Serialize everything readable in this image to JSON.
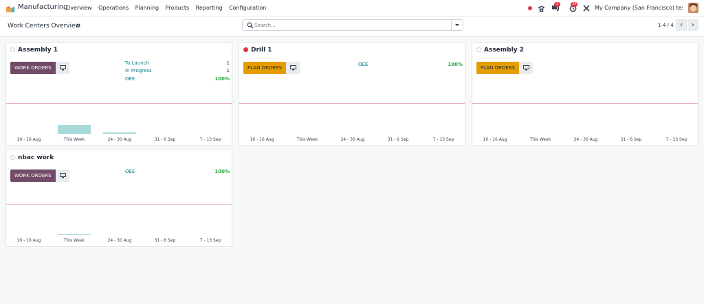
{
  "app": {
    "name": "Manufacturing"
  },
  "menu": [
    "Overview",
    "Operations",
    "Planning",
    "Products",
    "Reporting",
    "Configuration"
  ],
  "systray": {
    "chat_count": "2",
    "activity_count": "34",
    "company": "My Company (San Francisco) test te..."
  },
  "control": {
    "title": "Work Centers Overview",
    "search_placeholder": "Search...",
    "pager": "1-4 / 4"
  },
  "colors": {
    "brand": "#714b67",
    "plan": "#e59d00",
    "link": "#017e84",
    "success": "#28a745",
    "danger": "#dc3545",
    "bar": "#a6dbda"
  },
  "x_labels": [
    "10 - 16 Aug",
    "This Week",
    "24 - 30 Aug",
    "31 - 6 Sep",
    "7 - 13 Sep"
  ],
  "cards": [
    {
      "name": "Assembly 1",
      "status": "grey",
      "button": "WORK ORDERS",
      "stats": [
        {
          "label": "To Launch",
          "value": "1"
        },
        {
          "label": "In Progress",
          "value": "1"
        },
        {
          "label": "OEE",
          "value": "100%"
        }
      ],
      "graph": [
        0,
        1,
        0.15,
        0,
        0
      ]
    },
    {
      "name": "Drill 1",
      "status": "red",
      "button": "PLAN ORDERS",
      "stats": [
        {
          "label": "OEE",
          "value": "100%"
        }
      ],
      "graph": [
        0,
        0,
        0,
        0,
        0
      ]
    },
    {
      "name": "Assembly 2",
      "status": "grey",
      "button": "PLAN ORDERS",
      "stats": [],
      "graph": [
        0,
        0,
        0,
        0,
        0
      ]
    },
    {
      "name": "nbac work",
      "status": "grey",
      "button": "WORK ORDERS",
      "stats": [
        {
          "label": "OEE",
          "value": "100%"
        }
      ],
      "graph": [
        0,
        0.08,
        0,
        0,
        0
      ]
    }
  ]
}
